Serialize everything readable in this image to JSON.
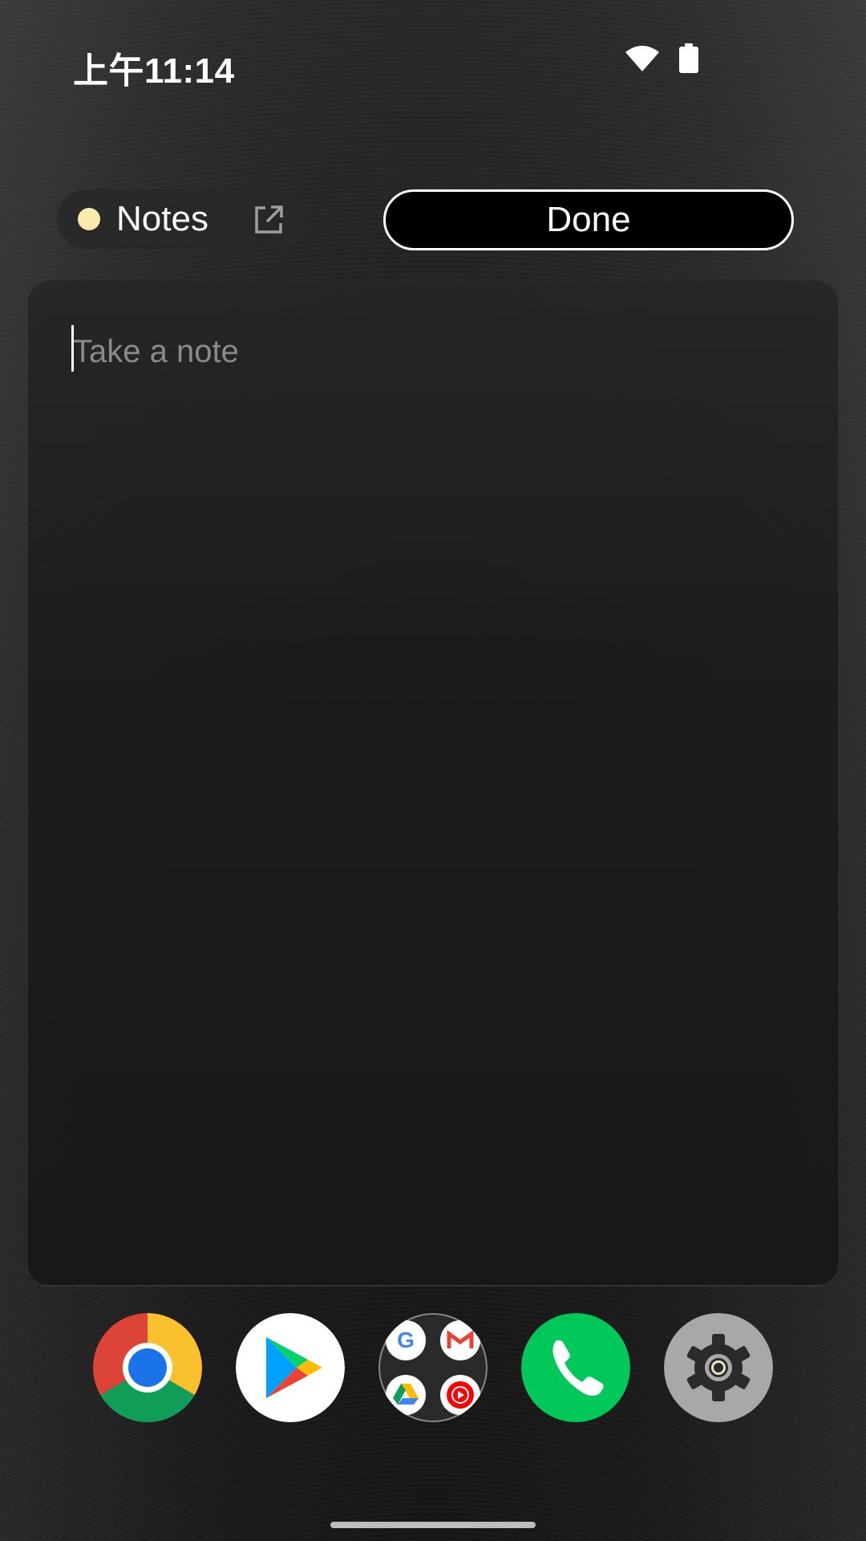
{
  "status_bar": {
    "time": "上午11:14",
    "icons": [
      "wifi-icon",
      "battery-icon"
    ]
  },
  "header": {
    "app_label": "Notes",
    "app_dot_color": "#fde9a9",
    "open_icon": "open-in-new-icon",
    "done_label": "Done"
  },
  "note": {
    "placeholder": "Take a note",
    "value": ""
  },
  "dock": {
    "apps": [
      "chrome-icon",
      "play-store-icon",
      "google-apps-folder-icon",
      "phone-icon",
      "settings-icon"
    ],
    "folder_apps": [
      "google-icon",
      "gmail-icon",
      "drive-icon",
      "youtube-music-icon"
    ]
  },
  "colors": {
    "accent_dot": "#fde9a9",
    "phone_green": "#00c95a"
  }
}
